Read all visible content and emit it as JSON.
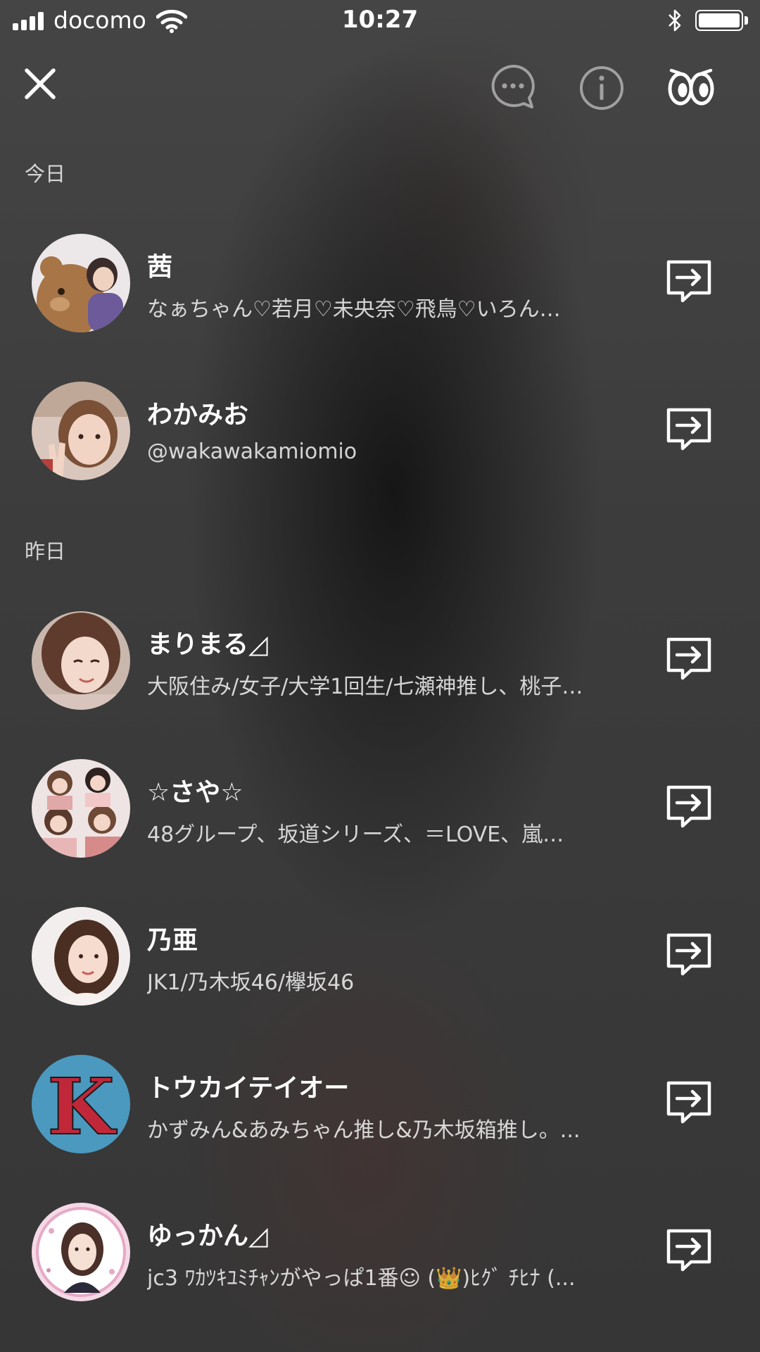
{
  "status_bar": {
    "carrier": "docomo",
    "time": "10:27"
  },
  "header": {
    "close_icon": "close-icon",
    "chat_icon": "chat-bubble-icon",
    "info_icon": "info-icon",
    "brand_icon": "eyes-icon"
  },
  "sections": [
    {
      "label": "今日",
      "users": [
        {
          "name": "茜",
          "desc": "なぁちゃん♡若月♡未央奈♡飛鳥♡いろん…"
        },
        {
          "name": "わかみお",
          "desc": "@wakawakamiomio"
        }
      ]
    },
    {
      "label": "昨日",
      "users": [
        {
          "name": "まりまる◿",
          "desc": "大阪住み/女子/大学1回生/七瀬神推し、桃子…"
        },
        {
          "name": "☆さや☆",
          "desc": "48グループ、坂道シリーズ、＝LOVE、嵐…"
        },
        {
          "name": "乃亜",
          "desc": "JK1/乃木坂46/欅坂46"
        },
        {
          "name": "トウカイテイオー",
          "desc": "かずみん&あみちゃん推し&乃木坂箱推し。..."
        },
        {
          "name": "ゆっかん◿",
          "desc": "jc3 ﾜｶﾂｷﾕﾐﾁｬﾝがやっぱ1番☺ (👑)ﾋｸﾞ ﾁﾋﾅ (..."
        }
      ]
    }
  ],
  "avatar_logo_text": "K",
  "colors": {
    "text_primary": "#ffffff",
    "text_secondary": "#cccccc",
    "icon_dim": "#a0a0a0"
  }
}
